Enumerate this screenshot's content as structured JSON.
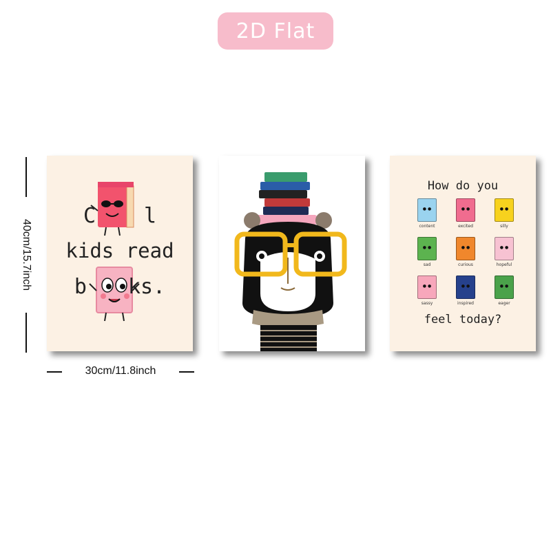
{
  "badge": {
    "label": "2D Flat"
  },
  "dimensions": {
    "height": "40cm/15.7inch",
    "width": "30cm/11.8inch"
  },
  "poster_left": {
    "line1_a": "C",
    "line1_b": "l",
    "line2": "kids read",
    "line3_a": "b",
    "line3_b": "ks."
  },
  "poster_middle": {
    "theme": "panda with glasses and stack of books",
    "accent_color": "#f1b81c"
  },
  "poster_right": {
    "top_text": "How do you",
    "bottom_text": "feel today?",
    "moods": [
      {
        "label": "content",
        "color": "#9ad3ef"
      },
      {
        "label": "excited",
        "color": "#f06c8f"
      },
      {
        "label": "silly",
        "color": "#f7d21e"
      },
      {
        "label": "sad",
        "color": "#5cb34f"
      },
      {
        "label": "curious",
        "color": "#f0872c"
      },
      {
        "label": "hopeful",
        "color": "#f7c2d2"
      },
      {
        "label": "sassy",
        "color": "#f7a7bb"
      },
      {
        "label": "inspired",
        "color": "#26418c"
      },
      {
        "label": "eager",
        "color": "#4aa24a"
      }
    ]
  }
}
